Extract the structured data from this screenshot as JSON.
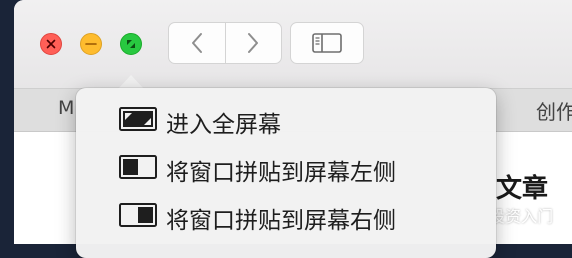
{
  "window": {
    "tab_left_label": "M",
    "tab_right_label": "创作",
    "content_heading": "文章"
  },
  "watermark": "知乎 @投资入门",
  "menu": {
    "items": [
      {
        "label": "进入全屏幕",
        "icon": "enter-fullscreen-icon"
      },
      {
        "label": "将窗口拼贴到屏幕左侧",
        "icon": "tile-left-icon"
      },
      {
        "label": "将窗口拼贴到屏幕右侧",
        "icon": "tile-right-icon"
      }
    ]
  },
  "colors": {
    "close": "#ff5f57",
    "minimize": "#febc2e",
    "fullscreen": "#28c840"
  }
}
